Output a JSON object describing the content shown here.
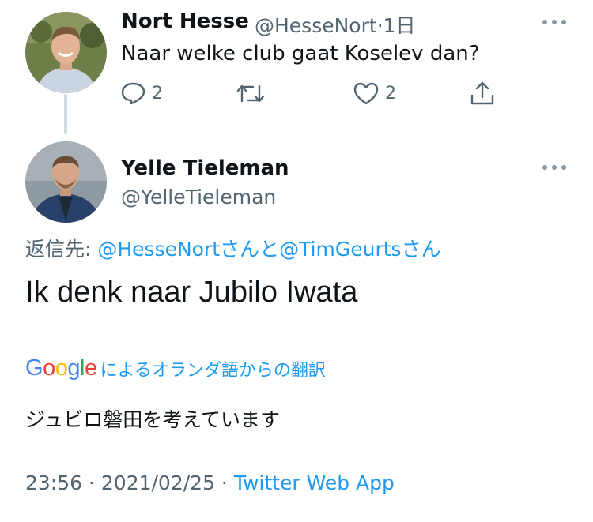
{
  "parent_tweet": {
    "name": "Nort Hesse",
    "handle": "@HesseNort",
    "separator": "·",
    "time": "1日",
    "text": "Naar welke club gaat Koselev dan?",
    "reply_count": "2",
    "like_count": "2",
    "icons": [
      "reply-icon",
      "retweet-icon",
      "like-icon",
      "share-icon",
      "more-icon"
    ]
  },
  "main_tweet": {
    "name": "Yelle Tieleman",
    "handle": "@YelleTieleman",
    "reply_prefix": "返信先: ",
    "reply_user1": "@HesseNort",
    "reply_connector": "さんと",
    "reply_user2": "@TimGeurts",
    "reply_suffix": "さん",
    "text": "Ik denk naar Jubilo Iwata",
    "translation_label": "によるオランダ語からの翻訳",
    "translation": "ジュビロ磐田を考えています",
    "time": "23:56",
    "dot": " · ",
    "date": "2021/02/25",
    "app": "Twitter Web App"
  },
  "google_logo": {
    "letters": [
      "G",
      "o",
      "o",
      "g",
      "l",
      "e"
    ]
  },
  "colors": {
    "accent": "#1d9bf0",
    "secondary_text": "#536471",
    "primary_text": "#0f1419",
    "google_blue": "#4285F4",
    "google_red": "#EA4335",
    "google_yellow": "#FBBC05",
    "google_green": "#34A853"
  }
}
